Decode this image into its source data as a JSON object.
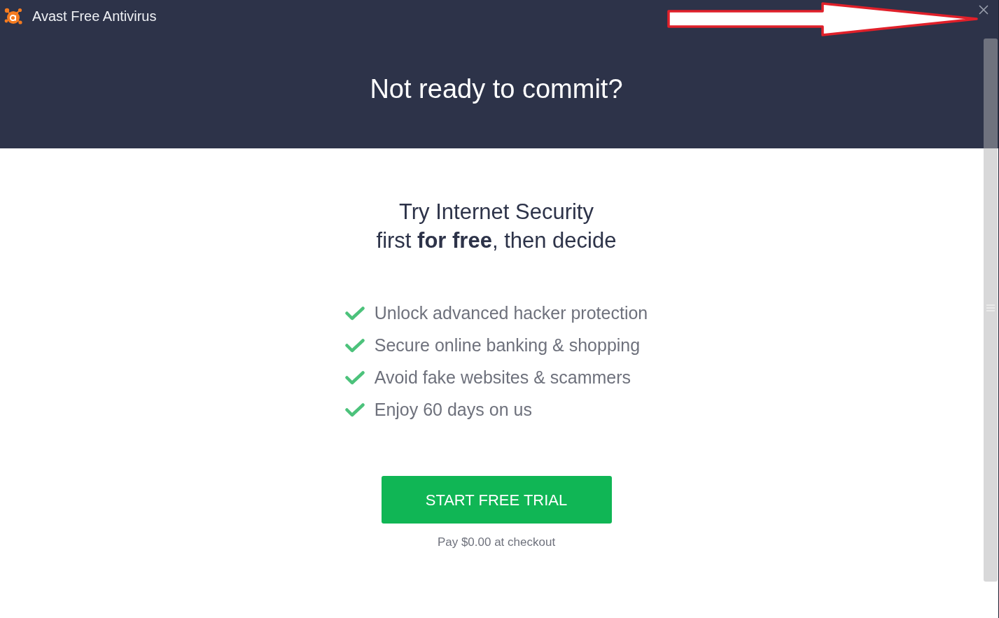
{
  "window": {
    "title": "Avast Free Antivirus"
  },
  "header": {
    "heading": "Not ready to commit?"
  },
  "offer": {
    "title_lines": [
      "Try Internet Security",
      "first **for free**, then decide"
    ]
  },
  "features": [
    "Unlock advanced hacker protection",
    "Secure online banking & shopping",
    "Avoid fake websites & scammers",
    "Enjoy 60 days on us"
  ],
  "cta": {
    "button": "START FREE TRIAL",
    "note": "Pay $0.00 at checkout"
  }
}
